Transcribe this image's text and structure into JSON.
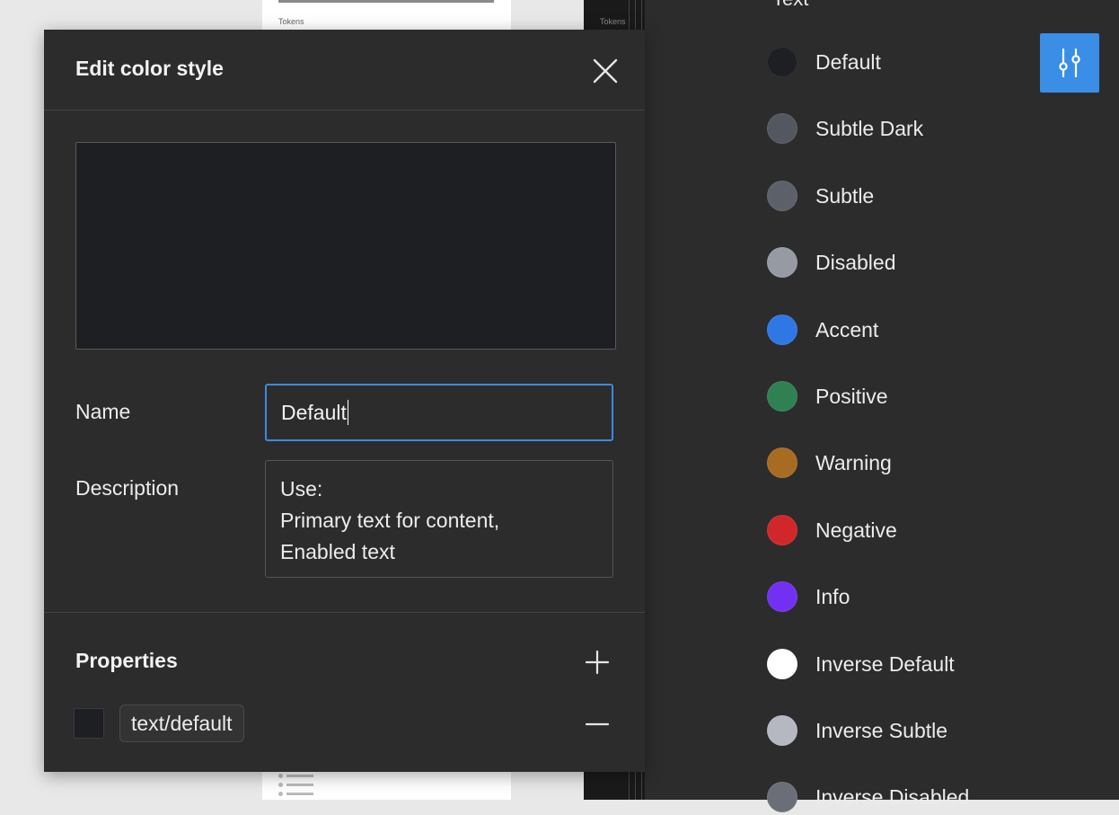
{
  "canvas": {
    "artboard_label": "Tokens"
  },
  "dialog": {
    "title": "Edit color style",
    "preview_color": "#1e1f22",
    "name_label": "Name",
    "name_value": "Default",
    "description_label": "Description",
    "description_lines": [
      "Use:",
      "Primary text for content,",
      "Enabled text"
    ],
    "properties_title": "Properties",
    "property": {
      "token": "text/default",
      "color": "#1e1f22"
    },
    "icons": {
      "close": "close-icon",
      "add": "plus-icon",
      "remove": "minus-icon"
    }
  },
  "styles_panel": {
    "heading": "Text",
    "adjust_button_icon": "sliders-icon",
    "accent": "#3a8ee6",
    "swatches": [
      {
        "label": "Default",
        "color": "#1e1f22"
      },
      {
        "label": "Subtle Dark",
        "color": "#53575f"
      },
      {
        "label": "Subtle",
        "color": "#5c6069"
      },
      {
        "label": "Disabled",
        "color": "#959aa3"
      },
      {
        "label": "Accent",
        "color": "#2f77e4"
      },
      {
        "label": "Positive",
        "color": "#2f8052"
      },
      {
        "label": "Warning",
        "color": "#a86b22"
      },
      {
        "label": "Negative",
        "color": "#d0282a"
      },
      {
        "label": "Info",
        "color": "#7230f2"
      },
      {
        "label": "Inverse Default",
        "color": "#ffffff"
      },
      {
        "label": "Inverse Subtle",
        "color": "#b5b8c0"
      },
      {
        "label": "Inverse Disabled",
        "color": "#6a6e77"
      }
    ]
  }
}
